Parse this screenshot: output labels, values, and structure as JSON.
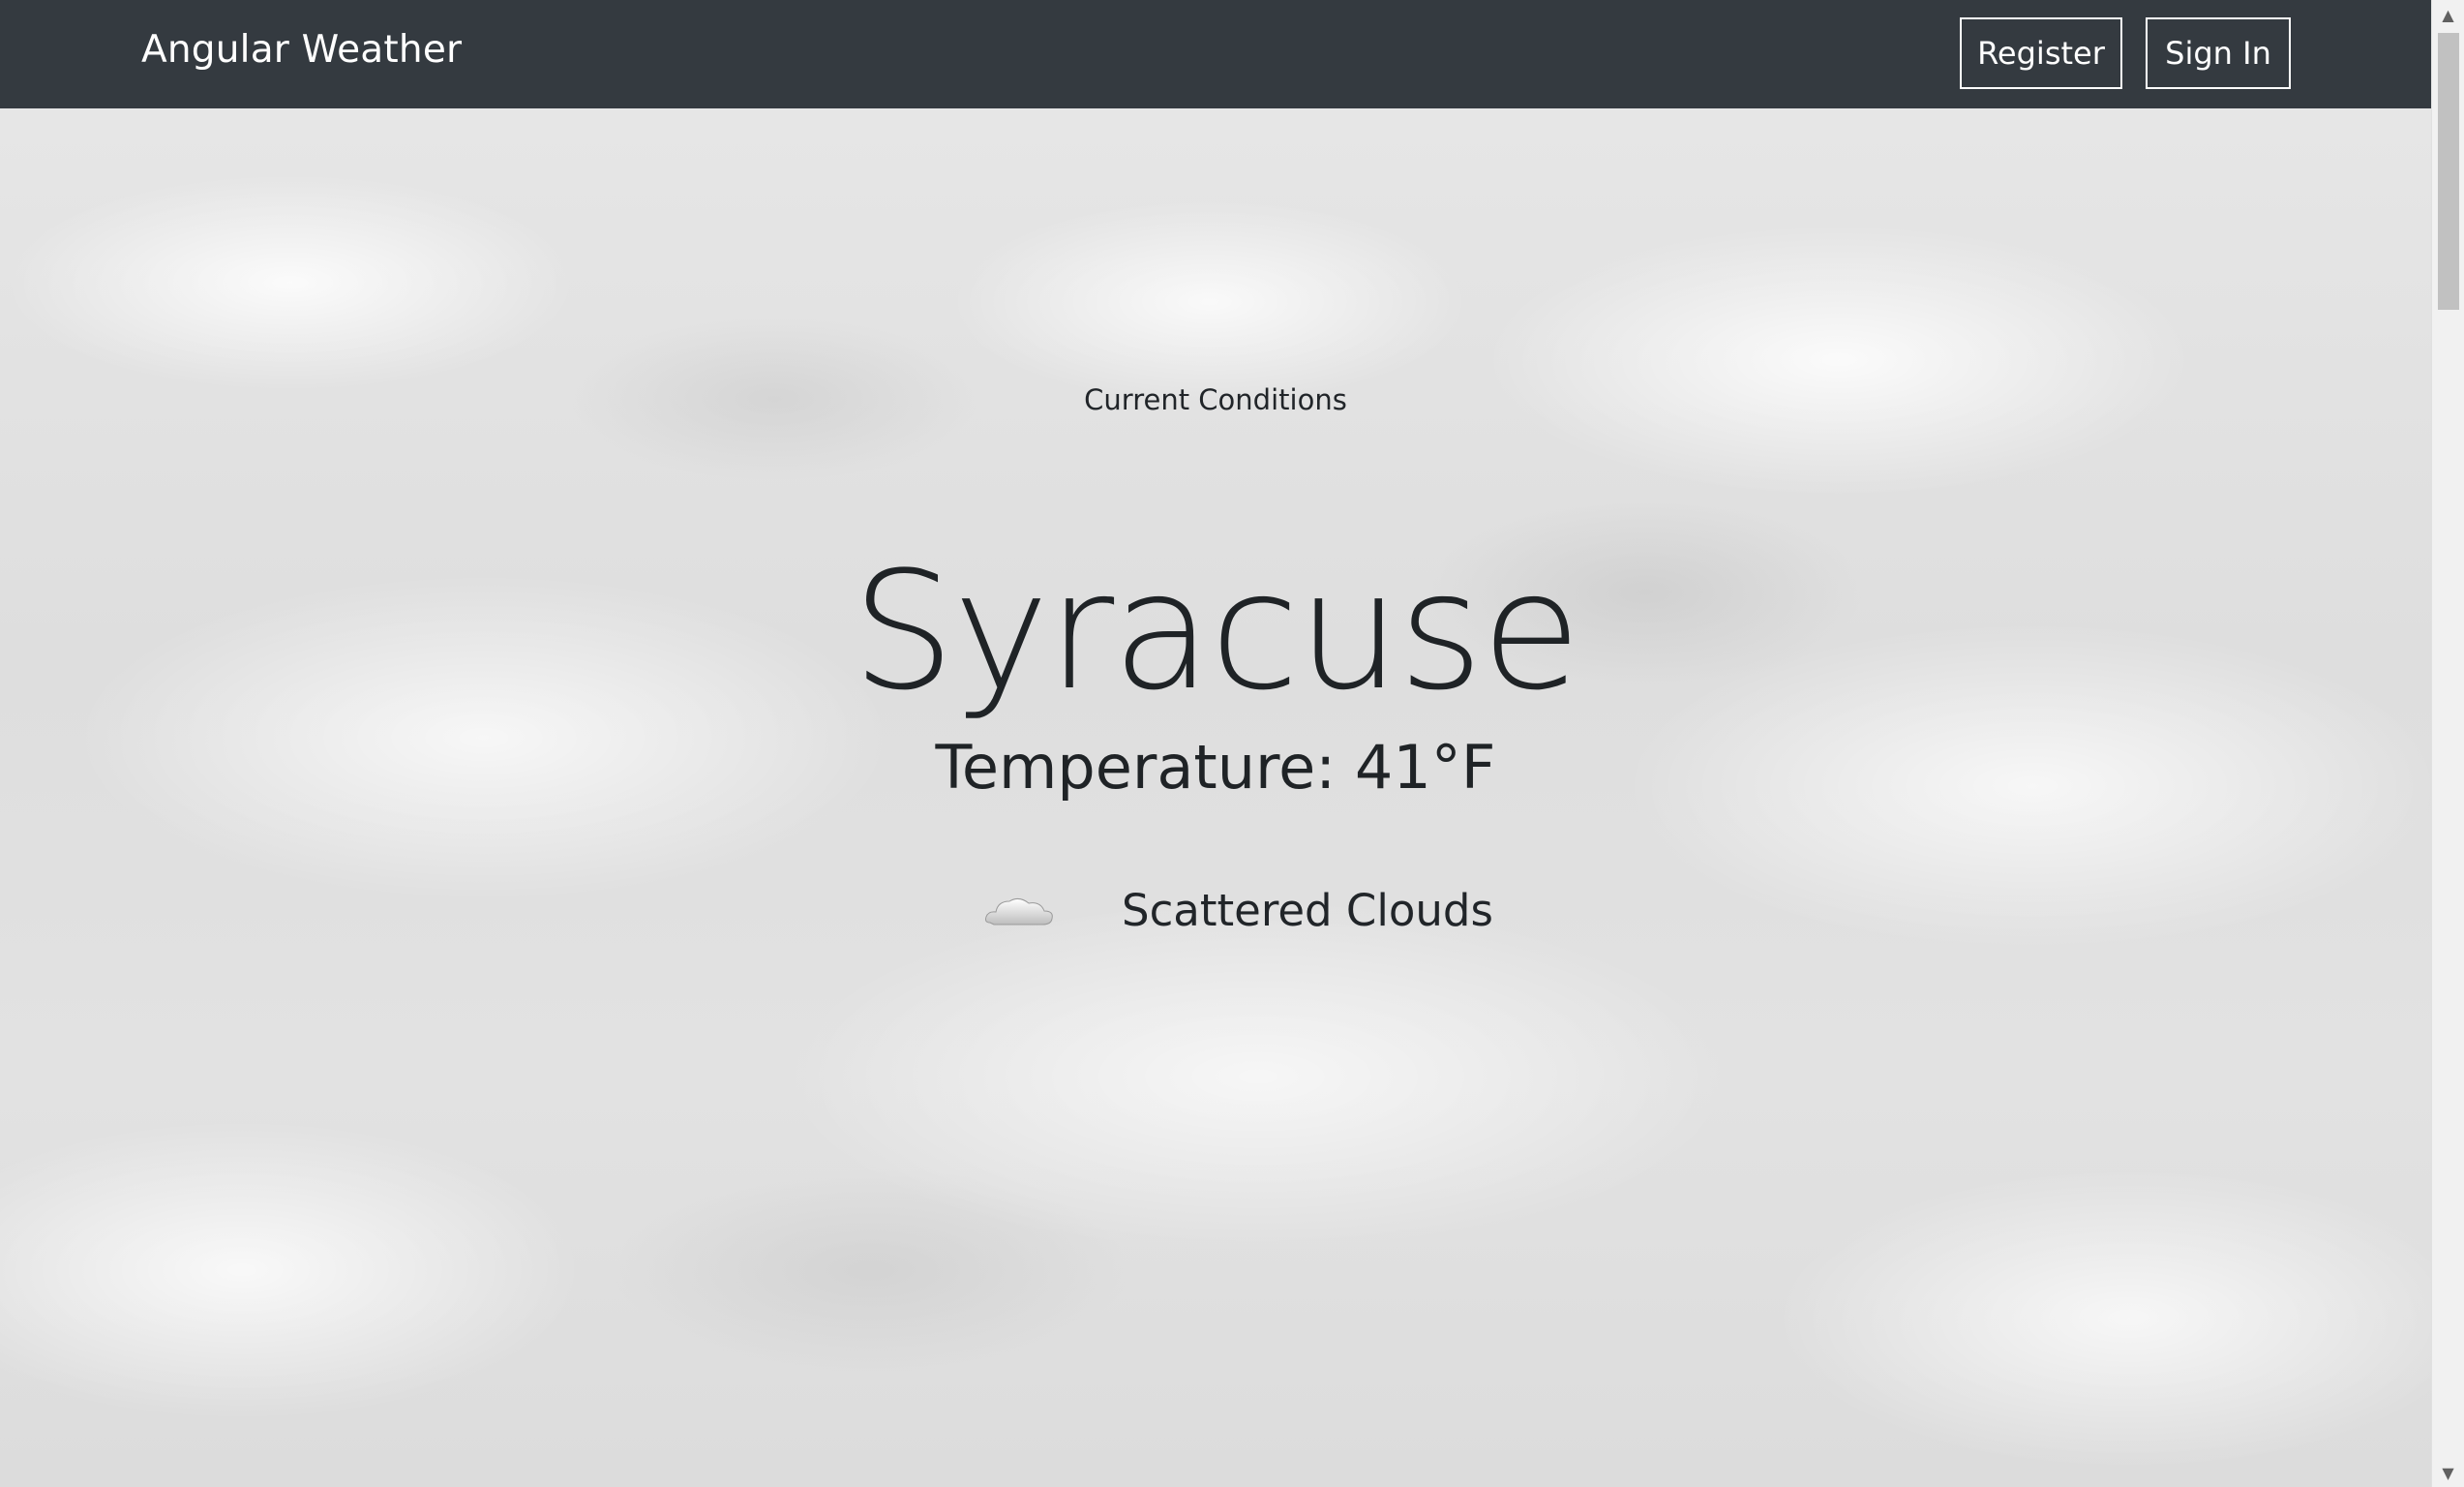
{
  "navbar": {
    "brand": "Angular Weather",
    "register_label": "Register",
    "signin_label": "Sign In",
    "background_color": "#343a40"
  },
  "main": {
    "section_label": "Current Conditions",
    "city": "Syracuse",
    "temperature": "Temperature: 41°F",
    "condition_icon": "cloud-icon",
    "condition": "Scattered Clouds"
  },
  "scrollbar": {
    "up_icon": "triangle-up-icon",
    "down_icon": "triangle-down-icon"
  }
}
